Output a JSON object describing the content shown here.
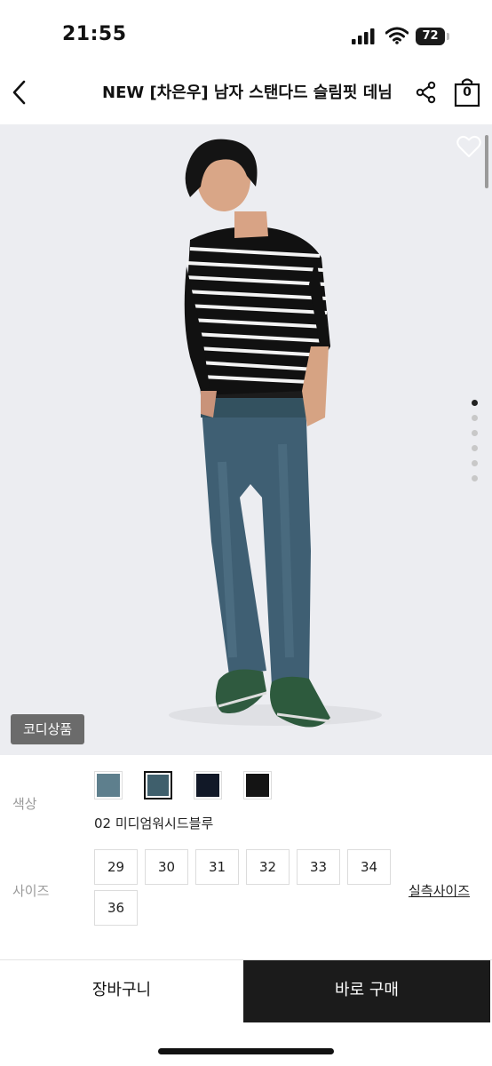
{
  "status_bar": {
    "time": "21:55",
    "battery": "72"
  },
  "header": {
    "title": "NEW [차은우] 남자 스탠다드 슬림핏 데님",
    "cart_count": "0"
  },
  "hero": {
    "badge": "코디상품",
    "image_count": 6,
    "active_image": 1
  },
  "options": {
    "color_label": "색상",
    "swatches": [
      {
        "color": "#5e7f8d",
        "selected": false
      },
      {
        "color": "#3f5f6c",
        "selected": true
      },
      {
        "color": "#111827",
        "selected": false
      },
      {
        "color": "#141414",
        "selected": false
      }
    ],
    "selected_color_name": "02 미디엄워시드블루",
    "size_label": "사이즈",
    "sizes": [
      "29",
      "30",
      "31",
      "32",
      "33",
      "34",
      "36"
    ],
    "size_guide": "실측사이즈"
  },
  "actions": {
    "add_to_cart": "장바구니",
    "buy_now": "바로 구매"
  }
}
